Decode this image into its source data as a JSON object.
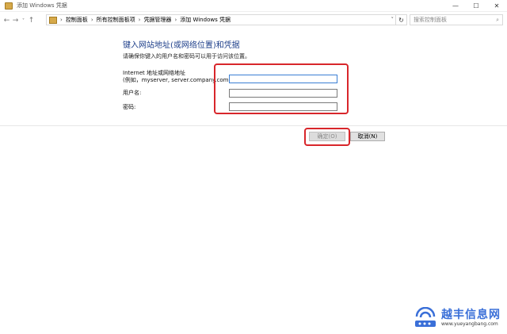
{
  "window": {
    "title": "添加 Windows 凭据",
    "controls": {
      "minimize": "—",
      "maximize": "☐",
      "close": "✕"
    }
  },
  "nav": {
    "back": "←",
    "forward": "→",
    "recent": "˅",
    "up": "↑",
    "breadcrumbs": [
      "控制面板",
      "所有控制面板项",
      "凭据管理器",
      "添加 Windows 凭据"
    ],
    "separator": "›",
    "address_dropdown": "˅",
    "refresh": "↻",
    "search_placeholder": "搜索控制面板",
    "search_icon": "⌕"
  },
  "form": {
    "heading": "键入网站地址(或网络位置)和凭据",
    "subtext": "请确保你键入的用户名和密码可以用于访问该位置。",
    "address_label_line1": "Internet 地址或网络地址",
    "address_label_line2": "(例如，myserver, server.company.com):",
    "username_label": "用户名:",
    "password_label": "密码:",
    "address_value": "",
    "username_value": "",
    "password_value": ""
  },
  "buttons": {
    "ok": "确定(O)",
    "cancel": "取消(N)"
  },
  "watermark": {
    "name": "越丰信息网",
    "url": "www.yueyangbang.com"
  },
  "colors": {
    "heading": "#1e3f8a",
    "highlight": "#d8262b",
    "watermark": "#3a6fd8"
  }
}
